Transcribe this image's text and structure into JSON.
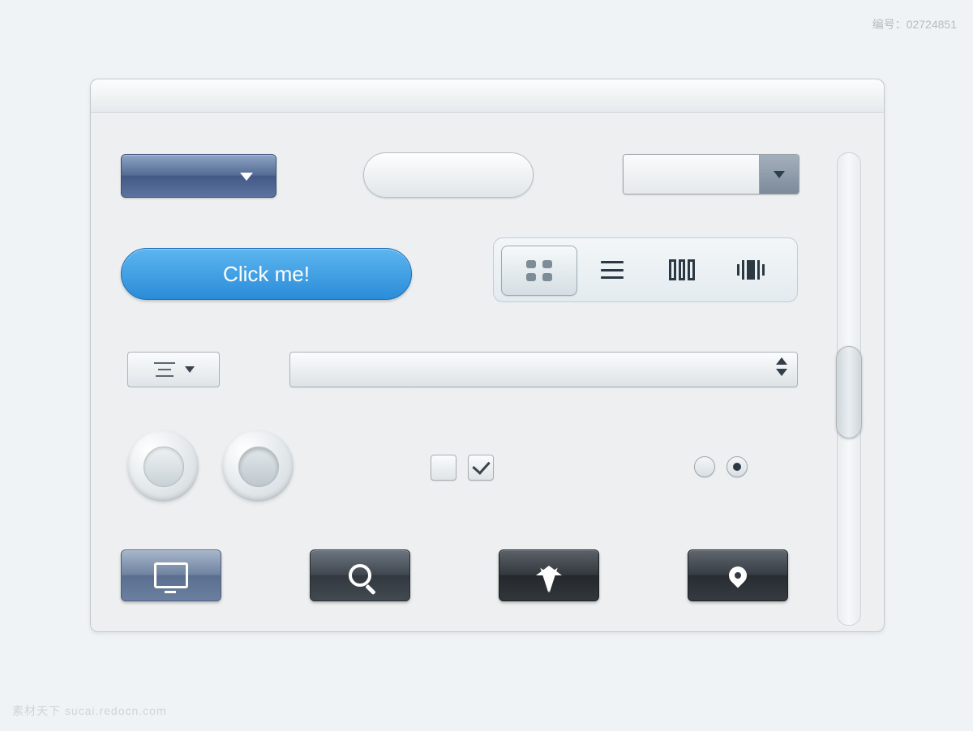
{
  "footer_watermark": "素材天下 sucai.redocn.com",
  "image_id_label": "编号：02724851",
  "buttons": {
    "click_me_label": "Click me!"
  },
  "colors": {
    "blue_dropdown": "#536a93",
    "blue_pill": "#2a8cd8",
    "dark_button": "#31383f",
    "panel_bg": "#edeff0"
  },
  "icons": {
    "dropdown": "chevron-down",
    "segmented": [
      "grid",
      "list",
      "columns",
      "barcode"
    ],
    "bottom_row": [
      "monitor",
      "search",
      "star",
      "location-pin"
    ]
  },
  "checkbox_states": [
    false,
    true
  ],
  "radio_states": [
    false,
    true
  ]
}
